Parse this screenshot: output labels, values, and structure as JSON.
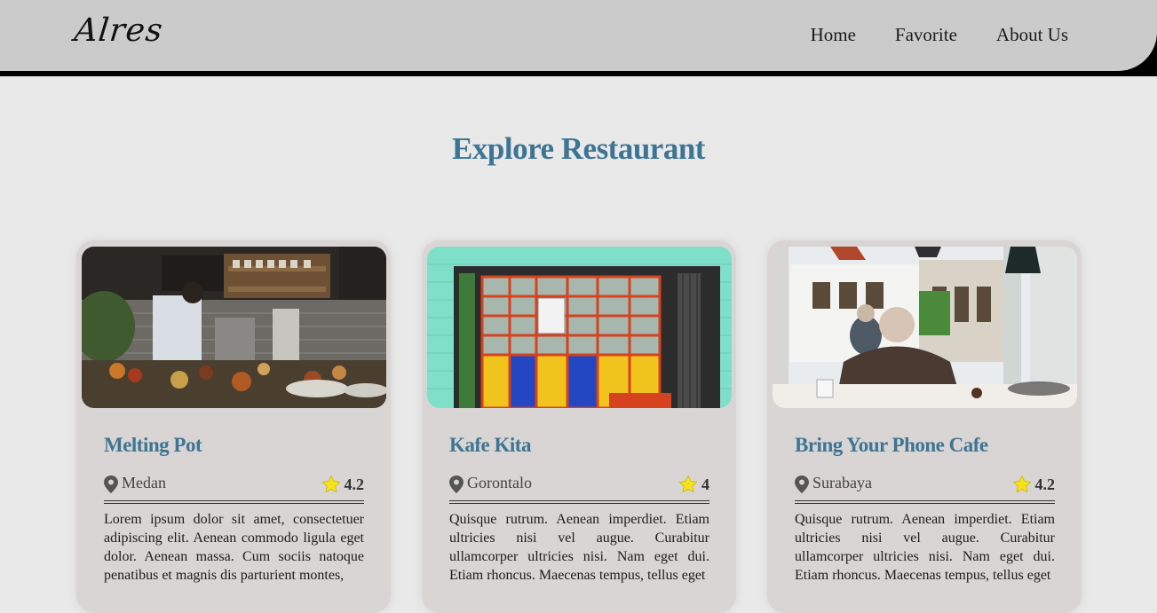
{
  "header": {
    "logo": "Alres",
    "nav": [
      {
        "label": "Home"
      },
      {
        "label": "Favorite"
      },
      {
        "label": "About Us"
      }
    ]
  },
  "main": {
    "title": "Explore Restaurant",
    "restaurants": [
      {
        "name": "Melting Pot",
        "city": "Medan",
        "rating": "4.2",
        "description": "Lorem ipsum dolor sit amet, consectetuer adipiscing elit. Aenean commodo ligula eget dolor. Aenean massa. Cum sociis natoque penatibus et magnis dis parturient montes,"
      },
      {
        "name": "Kafe Kita",
        "city": "Gorontalo",
        "rating": "4",
        "description": "Quisque rutrum. Aenean imperdiet. Etiam ultricies nisi vel augue. Curabitur ullamcorper ultricies nisi. Nam eget dui. Etiam rhoncus. Maecenas tempus, tellus eget"
      },
      {
        "name": "Bring Your Phone Cafe",
        "city": "Surabaya",
        "rating": "4.2",
        "description": "Quisque rutrum. Aenean imperdiet. Etiam ultricies nisi vel augue. Curabitur ullamcorper ultricies nisi. Nam eget dui. Etiam rhoncus. Maecenas tempus, tellus eget"
      }
    ]
  },
  "colors": {
    "accent": "#3f7594",
    "header_bg": "#cbcbcb",
    "page_bg": "#e9e9e9",
    "card_bg": "#d8d5d4",
    "star": "#f5e21b"
  },
  "icons": [
    "location-pin-icon",
    "star-icon"
  ]
}
